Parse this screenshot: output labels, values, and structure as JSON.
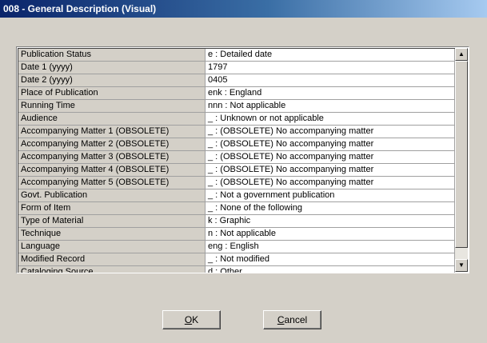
{
  "window": {
    "title": "008 - General Description (Visual)"
  },
  "rows": [
    {
      "label": "Publication Status",
      "value": "e : Detailed date"
    },
    {
      "label": "Date 1 (yyyy)",
      "value": "1797"
    },
    {
      "label": "Date 2 (yyyy)",
      "value": "0405"
    },
    {
      "label": "Place of Publication",
      "value": "enk : England"
    },
    {
      "label": "Running Time",
      "value": "nnn : Not applicable"
    },
    {
      "label": "Audience",
      "value": "_ : Unknown or not applicable"
    },
    {
      "label": "Accompanying Matter 1 (OBSOLETE)",
      "value": "_ : (OBSOLETE) No accompanying matter"
    },
    {
      "label": "Accompanying Matter 2 (OBSOLETE)",
      "value": "_ : (OBSOLETE) No accompanying matter"
    },
    {
      "label": "Accompanying Matter 3 (OBSOLETE)",
      "value": "_ : (OBSOLETE) No accompanying matter"
    },
    {
      "label": "Accompanying Matter 4 (OBSOLETE)",
      "value": "_ : (OBSOLETE) No accompanying matter"
    },
    {
      "label": "Accompanying Matter 5 (OBSOLETE)",
      "value": "_ : (OBSOLETE) No accompanying matter"
    },
    {
      "label": "Govt. Publication",
      "value": "_ : Not a government publication"
    },
    {
      "label": "Form of Item",
      "value": "_ : None of the following"
    },
    {
      "label": "Type of Material",
      "value": "k : Graphic"
    },
    {
      "label": "Technique",
      "value": "n : Not applicable"
    },
    {
      "label": "Language",
      "value": "eng : English"
    },
    {
      "label": "Modified Record",
      "value": "_ : Not modified"
    },
    {
      "label": "Cataloging Source",
      "value": "d : Other"
    }
  ],
  "buttons": {
    "ok": {
      "mnemonic": "O",
      "rest": "K"
    },
    "cancel": {
      "mnemonic": "C",
      "rest": "ancel"
    }
  },
  "icons": {
    "scroll_up": "up-arrow-icon",
    "scroll_down": "down-arrow-icon"
  }
}
